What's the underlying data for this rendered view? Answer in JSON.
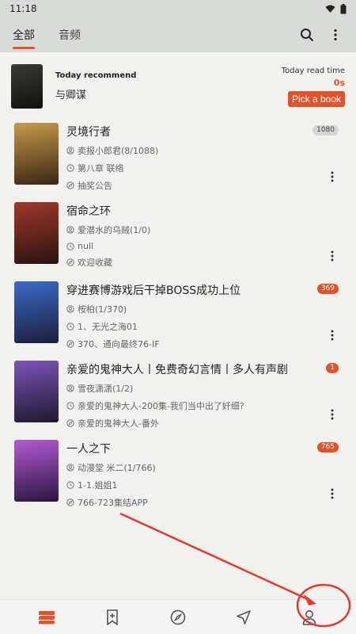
{
  "status": {
    "time": "11:18"
  },
  "header": {
    "tabs": [
      {
        "label": "全部"
      },
      {
        "label": "音频"
      }
    ]
  },
  "recommend": {
    "label": "Today recommend",
    "title": "与卿谋",
    "time_label": "Today read time",
    "time_value": "0s",
    "pick_label": "Pick a book"
  },
  "books": [
    {
      "title": "灵境行者",
      "author": "卖报小郎君(8/1088)",
      "latest": "第八章 联络",
      "note": "抽奖公告",
      "badge": "1080",
      "badge_style": "gray",
      "cover_colors": [
        "#c79a4a",
        "#3a2614"
      ]
    },
    {
      "title": "宿命之环",
      "author": "爱潜水的乌贼(1/0)",
      "latest": "null",
      "note": "欢迎收藏",
      "badge": "",
      "badge_style": "",
      "cover_colors": [
        "#a0382a",
        "#2a1410"
      ]
    },
    {
      "title": "穿进赛博游戏后干掉BOSS成功上位",
      "author": "桉柏(1/370)",
      "latest": "1、无光之海01",
      "note": "370、通向最终76-IF",
      "badge": "369",
      "badge_style": "red",
      "cover_colors": [
        "#3b6bc7",
        "#1a1f3c"
      ]
    },
    {
      "title": "亲爱的鬼神大人丨免费奇幻言情丨多人有声剧",
      "author": "雪夜潇潇(1/2)",
      "latest": "亲爱的鬼神大人-200集-我们当中出了奸细?",
      "note": "亲爱的鬼神大人-番外",
      "badge": "1",
      "badge_style": "red",
      "cover_colors": [
        "#7b54b8",
        "#1e1a2e"
      ]
    },
    {
      "title": "一人之下",
      "author": "动漫堂 米二(1/766)",
      "latest": "1-1.姐姐1",
      "note": "766-723集结APP",
      "badge": "765",
      "badge_style": "red",
      "cover_colors": [
        "#b25ad1",
        "#2a1640"
      ]
    }
  ],
  "bottom_nav": [
    {
      "icon": "bookshelf-icon"
    },
    {
      "icon": "bookmark-add-icon"
    },
    {
      "icon": "compass-icon"
    },
    {
      "icon": "navigation-icon"
    },
    {
      "icon": "person-icon"
    }
  ],
  "colors": {
    "accent": "#e2532a",
    "header_bg": "#d8dcd6",
    "page_bg": "#f2f1ee",
    "annotation": "#e53935"
  }
}
